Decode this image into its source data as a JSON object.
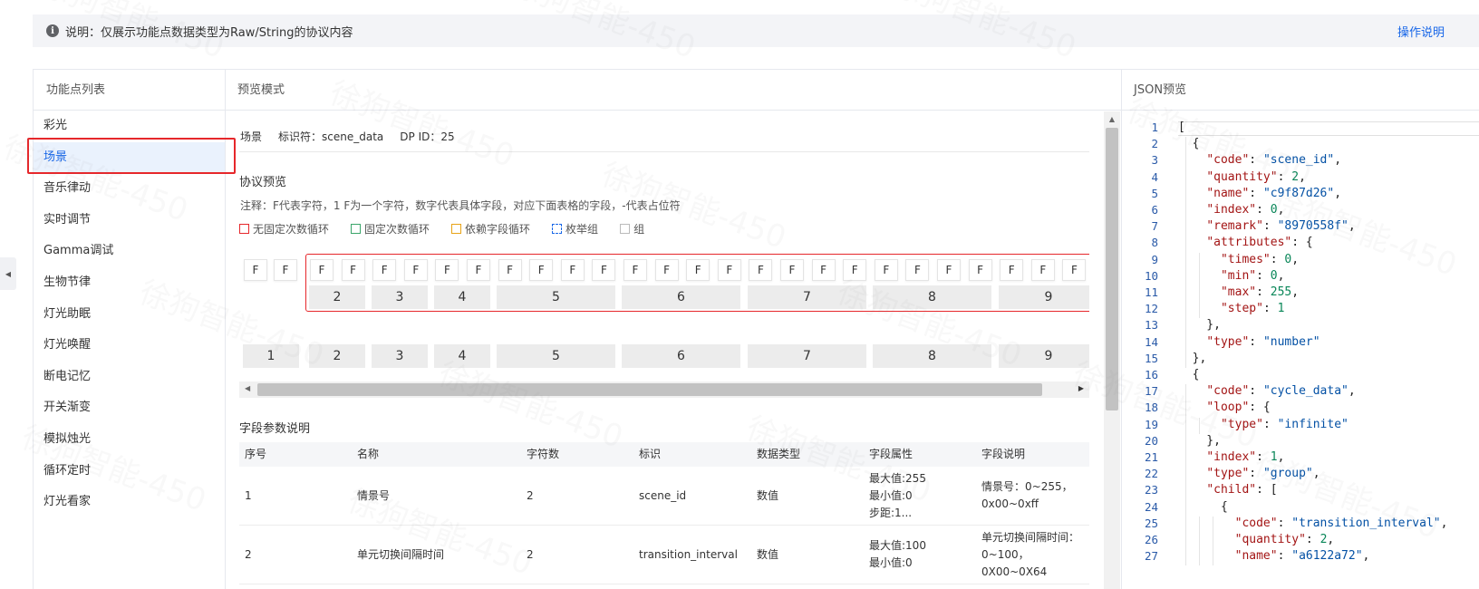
{
  "banner": {
    "text": "说明：仅展示功能点数据类型为Raw/String的协议内容",
    "help_link": "操作说明"
  },
  "left_panel": {
    "title": "功能点列表",
    "items": [
      "彩光",
      "场景",
      "音乐律动",
      "实时调节",
      "Gamma调试",
      "生物节律",
      "灯光助眠",
      "灯光唤醒",
      "断电记忆",
      "开关渐变",
      "模拟烛光",
      "循环定时",
      "灯光看家"
    ],
    "active_index": 1
  },
  "middle_panel": {
    "title": "预览模式",
    "meta": {
      "name": "场景",
      "identifier": "标识符：scene_data",
      "dp_id": "DP ID：25"
    },
    "protocol_title": "协议预览",
    "note": "注释：F代表字符，1 F为一个字符，数字代表具体字段，对应下面表格的字段，-代表占位符",
    "legend": [
      {
        "label": "无固定次数循环",
        "color": "#e6272b",
        "style": "solid"
      },
      {
        "label": "固定次数循环",
        "color": "#3aa56a",
        "style": "solid"
      },
      {
        "label": "依赖字段循环",
        "color": "#e8a317",
        "style": "solid"
      },
      {
        "label": "枚举组",
        "color": "#1766e8",
        "style": "dashed"
      },
      {
        "label": "组",
        "color": "#bbbbbb",
        "style": "solid"
      }
    ],
    "f_char": "F",
    "f_count": 27,
    "segments_top": [
      "2",
      "3",
      "4",
      "5",
      "6",
      "7",
      "8",
      "9"
    ],
    "segments_bottom": [
      "1",
      "2",
      "3",
      "4",
      "5",
      "6",
      "7",
      "8",
      "9"
    ],
    "field_title": "字段参数说明",
    "table": {
      "headers": [
        "序号",
        "名称",
        "字符数",
        "标识",
        "数据类型",
        "字段属性",
        "字段说明"
      ],
      "rows": [
        {
          "no": "1",
          "name": "情景号",
          "chars": "2",
          "id": "scene_id",
          "type": "数值",
          "attr": [
            "最大值:255",
            "最小值:0",
            "步距:1..."
          ],
          "desc": [
            "情景号：0~255，",
            "0x00~0xff"
          ]
        },
        {
          "no": "2",
          "name": "单元切换间隔时间",
          "chars": "2",
          "id": "transition_interval",
          "type": "数值",
          "attr": [
            "最大值:100",
            "最小值:0"
          ],
          "desc": [
            "单元切换间隔时间：",
            "0~100，0X00~0X64"
          ]
        }
      ]
    }
  },
  "right_panel": {
    "title": "JSON预览",
    "lines": [
      "[",
      "  {",
      "    \"code\": \"scene_id\",",
      "    \"quantity\": 2,",
      "    \"name\": \"c9f87d26\",",
      "    \"index\": 0,",
      "    \"remark\": \"8970558f\",",
      "    \"attributes\": {",
      "      \"times\": 0,",
      "      \"min\": 0,",
      "      \"max\": 255,",
      "      \"step\": 1",
      "    },",
      "    \"type\": \"number\"",
      "  },",
      "  {",
      "    \"code\": \"cycle_data\",",
      "    \"loop\": {",
      "      \"type\": \"infinite\"",
      "    },",
      "    \"index\": 1,",
      "    \"type\": \"group\",",
      "    \"child\": [",
      "      {",
      "        \"code\": \"transition_interval\",",
      "        \"quantity\": 2,",
      "        \"name\": \"a6122a72\","
    ]
  },
  "watermark": "徐狗智能-450"
}
